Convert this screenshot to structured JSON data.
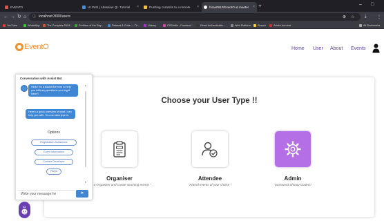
{
  "browser": {
    "tabs": [
      {
        "label": "EVENT0",
        "color": "#e0524a",
        "active": false
      },
      {
        "label": "UI Path | Atlassian Qt. Tutorial",
        "color": "#3d8fe0",
        "active": false
      },
      {
        "label": "Pushing commits to a remote",
        "color": "#f0c040",
        "active": false
      },
      {
        "label": "hima0912/EventO at master",
        "color": "#ffffff",
        "active": true
      }
    ],
    "url": "localhost:3000/users",
    "bookmarks": [
      {
        "label": "YouTube",
        "color": "#e33"
      },
      {
        "label": "WhatsApp",
        "color": "#3c3"
      },
      {
        "label": "The Complete 2024...",
        "color": "#c53"
      },
      {
        "label": "Problem of the Day...",
        "color": "#3a3"
      },
      {
        "label": "Dataset & Code — Th...",
        "color": "#48c"
      },
      {
        "label": "Udemy",
        "color": "#a3c"
      },
      {
        "label": "CSStudio - Frontend...",
        "color": "#d4a"
      },
      {
        "label": "React Authenticatio...",
        "color": "#333"
      },
      {
        "label": "Web Platform",
        "color": "#888"
      },
      {
        "label": "Search",
        "color": "#fc3"
      },
      {
        "label": "Adobe Acrobat",
        "color": "#c33"
      },
      {
        "label": "All Bookmarks",
        "color": "#aaa"
      }
    ]
  },
  "site": {
    "logo_text": "EventO",
    "nav": {
      "home": "Home",
      "user": "User",
      "about": "About",
      "events": "Events"
    },
    "brand_color": "#f09030"
  },
  "main": {
    "title": "Choose your User Type !!",
    "roles": [
      {
        "name": "Organiser",
        "desc": "\"Be a Organizer and create stunning events \"",
        "icon": "document-icon"
      },
      {
        "name": "Attendee",
        "desc": "\"Attend events of your choice \"",
        "icon": "user-check-icon"
      },
      {
        "name": "Admin",
        "desc": "\"password Shouty Coders\"",
        "icon": "gear-icon"
      }
    ]
  },
  "chat": {
    "header": "Conversation with Assist Bot",
    "messages": [
      "Hello! I'm a Assist Bot here to help you with any questions you might have !!",
      "Here's a quick overview of what I can help you with. You can also type in."
    ],
    "options_label": "Options",
    "options": [
      "Registration Assistance",
      "Event Information",
      "Contact Developer",
      "FAQs"
    ],
    "input_placeholder": "Write your message he",
    "send_icon": "send-icon",
    "launcher_label": "Bot"
  }
}
